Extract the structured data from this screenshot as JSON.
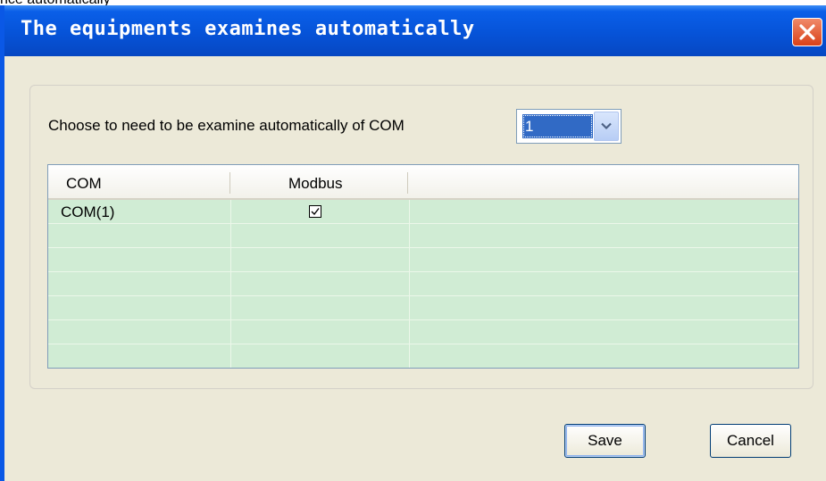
{
  "background_text": "rice automatically",
  "window": {
    "title": "The equipments examines automatically",
    "close_icon": "close-icon",
    "accent_color": "#0a58e6"
  },
  "form": {
    "prompt": "Choose to need to be examine automatically of COM",
    "com_select": {
      "value": "1",
      "arrow_icon": "chevron-down-icon"
    }
  },
  "grid": {
    "columns": [
      "COM",
      "Modbus",
      ""
    ],
    "rows": [
      {
        "com": "COM(1)",
        "modbus_checked": true
      }
    ],
    "row_color": "#d0ecd4"
  },
  "buttons": {
    "save": "Save",
    "cancel": "Cancel"
  }
}
